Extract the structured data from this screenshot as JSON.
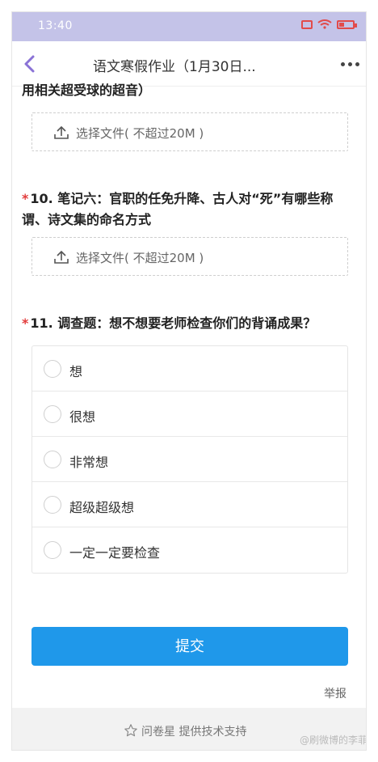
{
  "status": {
    "time": "13:40",
    "battery_label": ""
  },
  "nav": {
    "title": "语文寒假作业（1月30日..."
  },
  "cut_text": "用相关超受球的超音）",
  "uploads": [
    {
      "label": "选择文件( 不超过20M )"
    },
    {
      "label": "选择文件( 不超过20M )"
    }
  ],
  "questions": [
    {
      "required": "*",
      "title": "10. 笔记六：官职的任免升降、古人对“死”有哪些称谓、诗文集的命名方式"
    },
    {
      "required": "*",
      "title": "11. 调查题：想不想要老师检查你们的背诵成果？"
    }
  ],
  "options": [
    {
      "label": "想"
    },
    {
      "label": "很想"
    },
    {
      "label": "非常想"
    },
    {
      "label": "超级超级想"
    },
    {
      "label": "一定一定要检查"
    }
  ],
  "submit_label": "提交",
  "report_label": "举报",
  "footer": {
    "text": "问卷星 提供技术支持",
    "watermark": "@刷微博的李菲"
  },
  "colors": {
    "accent": "#1f98ea",
    "status_bar": "#c4c3e8",
    "required": "#e23b3b",
    "back_icon": "#8a72d6"
  }
}
